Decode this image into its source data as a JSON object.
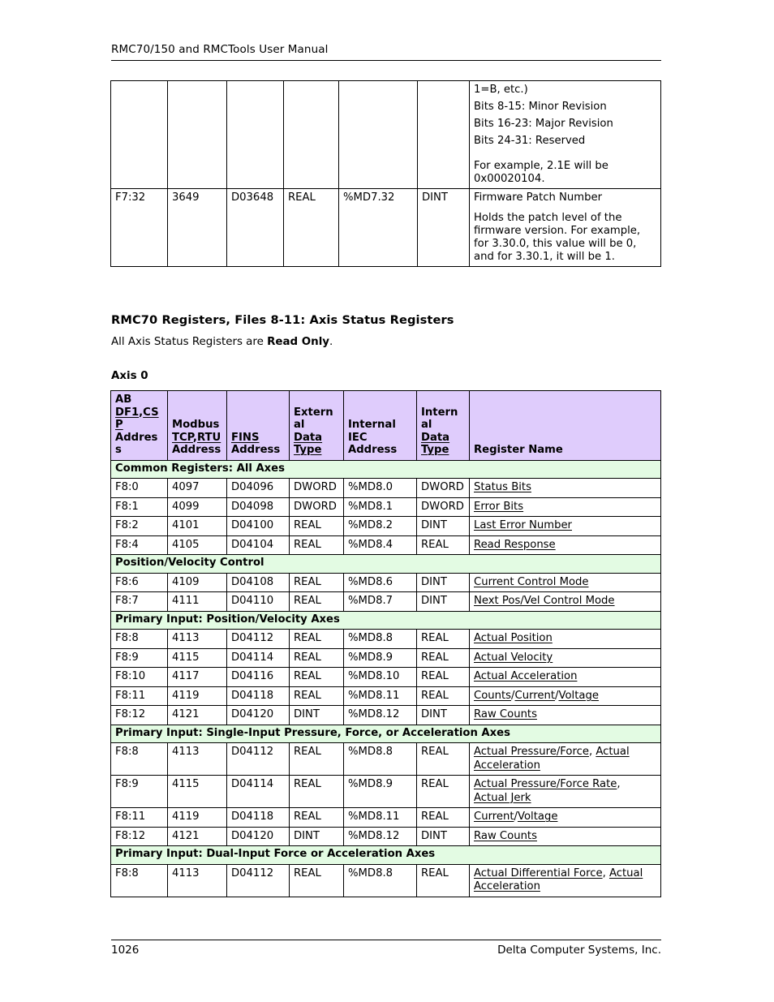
{
  "header": {
    "running_title": "RMC70/150 and RMCTools User Manual"
  },
  "top_table": {
    "continued_description_lines": [
      "1=B, etc.)",
      "Bits 8-15: Minor Revision",
      "Bits 16-23: Major Revision",
      "Bits 24-31: Reserved"
    ],
    "continued_example_lines": [
      "For example, 2.1E will be",
      "0x00020104."
    ],
    "row": {
      "ab_address": "F7:32",
      "modbus_address": "3649",
      "fins_address": "D03648",
      "external_data_type": "REAL",
      "internal_iec_address": "%MD7.32",
      "internal_data_type": "DINT",
      "register_name": "Firmware Patch Number",
      "register_description": "Holds the patch level of the firmware version. For example, for 3.30.0, this value will be 0, and for 3.30.1, it will be 1."
    }
  },
  "section": {
    "heading": "RMC70 Registers, Files 8-11: Axis Status Registers",
    "intro_prefix": "All Axis Status Registers are ",
    "intro_bold": "Read Only",
    "intro_suffix": ".",
    "axis_label": "Axis 0"
  },
  "main_table": {
    "colors": {
      "header_bg": "#dfccfc",
      "section_bg": "#e3fbe3",
      "border": "#000000"
    },
    "headers": {
      "ab_line1": "AB",
      "ab_link1": "DF1",
      "ab_comma": ",",
      "ab_link2": "CSP",
      "ab_line3": "Address",
      "modbus_line1": "Modbus",
      "modbus_link1": "TCP",
      "modbus_comma": ",",
      "modbus_link2": "RTU",
      "modbus_line3": "Address",
      "fins_link": "FINS",
      "fins_line2": "Address",
      "ext_line1": "External",
      "ext_link": "Data",
      "ext_link2": "Type",
      "iec_line1": "Internal",
      "iec_line2": "IEC",
      "iec_line3": "Address",
      "int_line1": "Internal",
      "int_link": "Data",
      "int_link2": "Type",
      "register_name": "Register Name"
    },
    "sections": [
      {
        "title": "Common Registers: All Axes",
        "rows": [
          {
            "ab": "F8:0",
            "modbus": "4097",
            "fins": "D04096",
            "ext": "DWORD",
            "iec": "%MD8.0",
            "int": "DWORD",
            "name_parts": [
              {
                "t": "Status Bits",
                "link": true
              }
            ]
          },
          {
            "ab": "F8:1",
            "modbus": "4099",
            "fins": "D04098",
            "ext": "DWORD",
            "iec": "%MD8.1",
            "int": "DWORD",
            "name_parts": [
              {
                "t": "Error Bits",
                "link": true
              }
            ]
          },
          {
            "ab": "F8:2",
            "modbus": "4101",
            "fins": "D04100",
            "ext": "REAL",
            "iec": "%MD8.2",
            "int": "DINT",
            "name_parts": [
              {
                "t": "Last Error Number",
                "link": true
              }
            ]
          },
          {
            "ab": "F8:4",
            "modbus": "4105",
            "fins": "D04104",
            "ext": "REAL",
            "iec": "%MD8.4",
            "int": "REAL",
            "name_parts": [
              {
                "t": "Read Response",
                "link": true
              }
            ]
          }
        ]
      },
      {
        "title": "Position/Velocity Control",
        "rows": [
          {
            "ab": "F8:6",
            "modbus": "4109",
            "fins": "D04108",
            "ext": "REAL",
            "iec": "%MD8.6",
            "int": "DINT",
            "name_parts": [
              {
                "t": "Current Control Mode",
                "link": true
              }
            ]
          },
          {
            "ab": "F8:7",
            "modbus": "4111",
            "fins": "D04110",
            "ext": "REAL",
            "iec": "%MD8.7",
            "int": "DINT",
            "name_parts": [
              {
                "t": "Next Pos/Vel Control Mode",
                "link": true
              }
            ]
          }
        ]
      },
      {
        "title": "Primary Input: Position/Velocity Axes",
        "rows": [
          {
            "ab": "F8:8",
            "modbus": "4113",
            "fins": "D04112",
            "ext": "REAL",
            "iec": "%MD8.8",
            "int": "REAL",
            "name_parts": [
              {
                "t": "Actual Position",
                "link": true
              }
            ]
          },
          {
            "ab": "F8:9",
            "modbus": "4115",
            "fins": "D04114",
            "ext": "REAL",
            "iec": "%MD8.9",
            "int": "REAL",
            "name_parts": [
              {
                "t": "Actual Velocity",
                "link": true
              }
            ]
          },
          {
            "ab": "F8:10",
            "modbus": "4117",
            "fins": "D04116",
            "ext": "REAL",
            "iec": "%MD8.10",
            "int": "REAL",
            "name_parts": [
              {
                "t": "Actual Acceleration",
                "link": true
              }
            ]
          },
          {
            "ab": "F8:11",
            "modbus": "4119",
            "fins": "D04118",
            "ext": "REAL",
            "iec": "%MD8.11",
            "int": "REAL",
            "name_parts": [
              {
                "t": "Counts",
                "link": true
              },
              {
                "t": "/",
                "link": false
              },
              {
                "t": "Current",
                "link": true
              },
              {
                "t": "/",
                "link": false
              },
              {
                "t": "Voltage",
                "link": true
              }
            ]
          },
          {
            "ab": "F8:12",
            "modbus": "4121",
            "fins": "D04120",
            "ext": "DINT",
            "iec": "%MD8.12",
            "int": "DINT",
            "name_parts": [
              {
                "t": "Raw Counts",
                "link": true
              }
            ]
          }
        ]
      },
      {
        "title": "Primary Input: Single-Input Pressure, Force, or Acceleration Axes",
        "rows": [
          {
            "ab": "F8:8",
            "modbus": "4113",
            "fins": "D04112",
            "ext": "REAL",
            "iec": "%MD8.8",
            "int": "REAL",
            "name_parts": [
              {
                "t": "Actual Pressure/Force",
                "link": true
              },
              {
                "t": ", ",
                "link": false
              },
              {
                "t": "Actual Acceleration",
                "link": true
              }
            ]
          },
          {
            "ab": "F8:9",
            "modbus": "4115",
            "fins": "D04114",
            "ext": "REAL",
            "iec": "%MD8.9",
            "int": "REAL",
            "bottom_align_first_two": true,
            "name_parts": [
              {
                "t": "Actual Pressure/Force Rate",
                "link": true
              },
              {
                "t": ", ",
                "link": false
              },
              {
                "t": "Actual Jerk",
                "link": true
              }
            ]
          },
          {
            "ab": "F8:11",
            "modbus": "4119",
            "fins": "D04118",
            "ext": "REAL",
            "iec": "%MD8.11",
            "int": "REAL",
            "name_parts": [
              {
                "t": "Current",
                "link": true
              },
              {
                "t": "/",
                "link": false
              },
              {
                "t": "Voltage",
                "link": true
              }
            ]
          },
          {
            "ab": "F8:12",
            "modbus": "4121",
            "fins": "D04120",
            "ext": "DINT",
            "iec": "%MD8.12",
            "int": "DINT",
            "name_parts": [
              {
                "t": "Raw Counts",
                "link": true
              }
            ]
          }
        ]
      },
      {
        "title": "Primary Input: Dual-Input Force or Acceleration Axes",
        "rows": [
          {
            "ab": "F8:8",
            "modbus": "4113",
            "fins": "D04112",
            "ext": "REAL",
            "iec": "%MD8.8",
            "int": "REAL",
            "name_parts": [
              {
                "t": "Actual Differential Force",
                "link": true
              },
              {
                "t": ", ",
                "link": false
              },
              {
                "t": "Actual Acceleration",
                "link": true
              }
            ]
          }
        ]
      }
    ]
  },
  "footer": {
    "page_number": "1026",
    "company": "Delta Computer Systems, Inc."
  }
}
